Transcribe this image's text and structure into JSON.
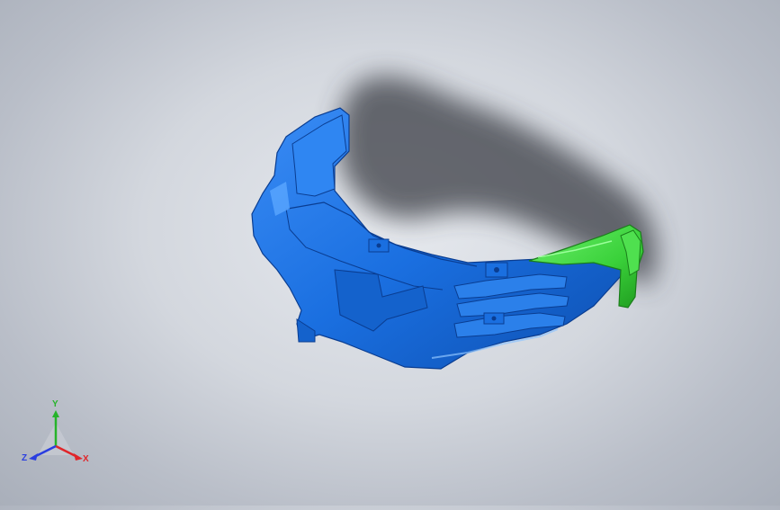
{
  "triad": {
    "x_label": "X",
    "y_label": "Y",
    "z_label": "Z",
    "x_color": "#e0262a",
    "y_color": "#26b32a",
    "z_color": "#2a3ee0"
  },
  "model": {
    "body_color": "#1a6fe0",
    "body_shade": "#0f4fb8",
    "body_light": "#3d95ff",
    "part_color": "#3ad13a",
    "part_shade": "#239a23",
    "shadow_color": "#3a3d45"
  }
}
